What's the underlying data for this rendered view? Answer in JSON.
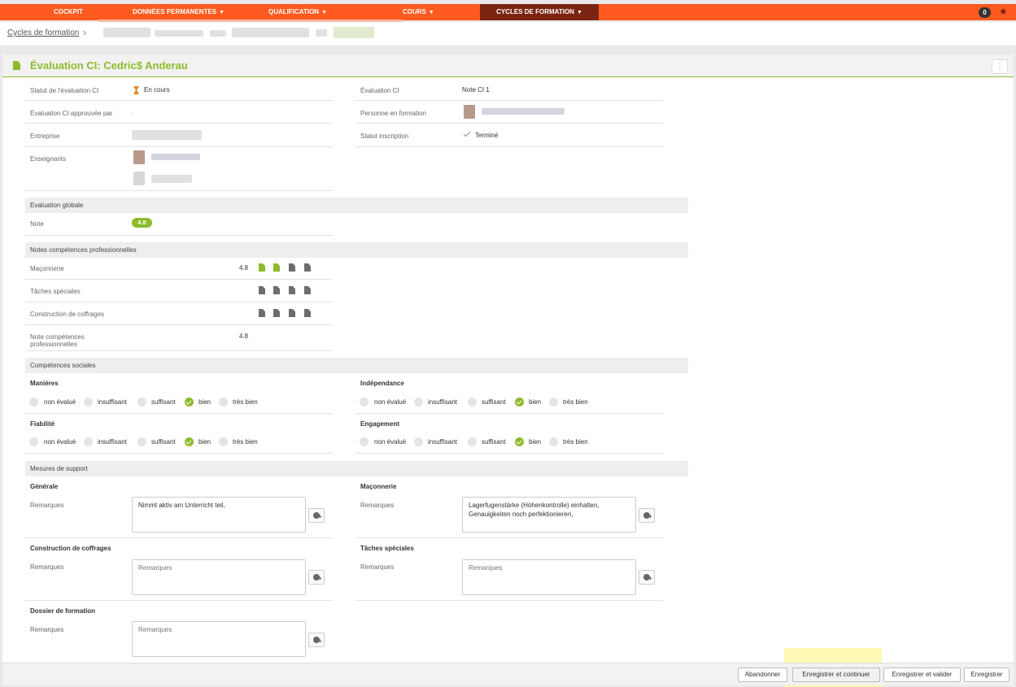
{
  "nav": {
    "cockpit": "COCKPIT",
    "donnees": "DONNÉES PERMANENTES",
    "qualification": "QUALIFICATION",
    "cours": "COURS",
    "cycles": "CYCLES DE FORMATION",
    "caret": "▼",
    "notif_count": "0",
    "star": "★"
  },
  "breadcrumb": {
    "root": "Cycles de formation",
    "sep": "›"
  },
  "panel": {
    "title": "Évaluation CI: Cedric$ Anderau",
    "menu": "⋮"
  },
  "details": {
    "statut_label": "Statut de l'évaluation CI",
    "statut_value": "En cours",
    "approuvee_label": "Évaluation CI approuvée par",
    "approuvee_value": "-",
    "entreprise_label": "Entreprise",
    "enseignants_label": "Enseignants",
    "evaluation_label": "Évaluation CI",
    "evaluation_value": "Note CI 1",
    "personne_label": "Personne en formation",
    "inscription_label": "Statut inscription",
    "inscription_value": "Terminé"
  },
  "globale": {
    "section": "Evaluation globale",
    "note_label": "Note",
    "note_value": "4.8"
  },
  "pro": {
    "section": "Notes compétences professionnelles",
    "rows": [
      {
        "label": "Maçonnerie",
        "value": "4.8"
      },
      {
        "label": "Tâches spéciales",
        "value": ""
      },
      {
        "label": "Construction de coffrages",
        "value": ""
      }
    ],
    "total_label": "Note compétences professionnelles",
    "total_value": "4.8"
  },
  "sociales": {
    "section": "Compétences sociales",
    "options": [
      "non évalué",
      "insuffisant",
      "suffisant",
      "bien",
      "très bien"
    ],
    "groups": [
      {
        "title": "Manières",
        "selected": "bien"
      },
      {
        "title": "Indépendance",
        "selected": "bien"
      },
      {
        "title": "Fiabilité",
        "selected": "bien"
      },
      {
        "title": "Engagement",
        "selected": "bien"
      }
    ]
  },
  "support": {
    "section": "Mesures de support",
    "remarks_label": "Remarques",
    "placeholder": "Remarques",
    "blocks": [
      {
        "title": "Générale",
        "text": "Nimmt aktiv am Unterricht teil,"
      },
      {
        "title": "Maçonnerie",
        "text": "Lagerfugenstärke (Höhenkontrolle) einhalten, Genauigkeiten noch perfektionieren,"
      },
      {
        "title": "Construction de coffrages",
        "text": ""
      },
      {
        "title": "Tâches spéciales",
        "text": ""
      },
      {
        "title": "Dossier de formation",
        "text": ""
      }
    ]
  },
  "footer": {
    "abandonner": "Abandonner",
    "continuer": "Enregistrer et continuer",
    "valider": "Enregistrer et valider",
    "enregistrer": "Enregistrer"
  },
  "colors": {
    "nav": "#ff5a1f",
    "nav_active": "#7a2411",
    "accent": "#8dbb2b"
  }
}
